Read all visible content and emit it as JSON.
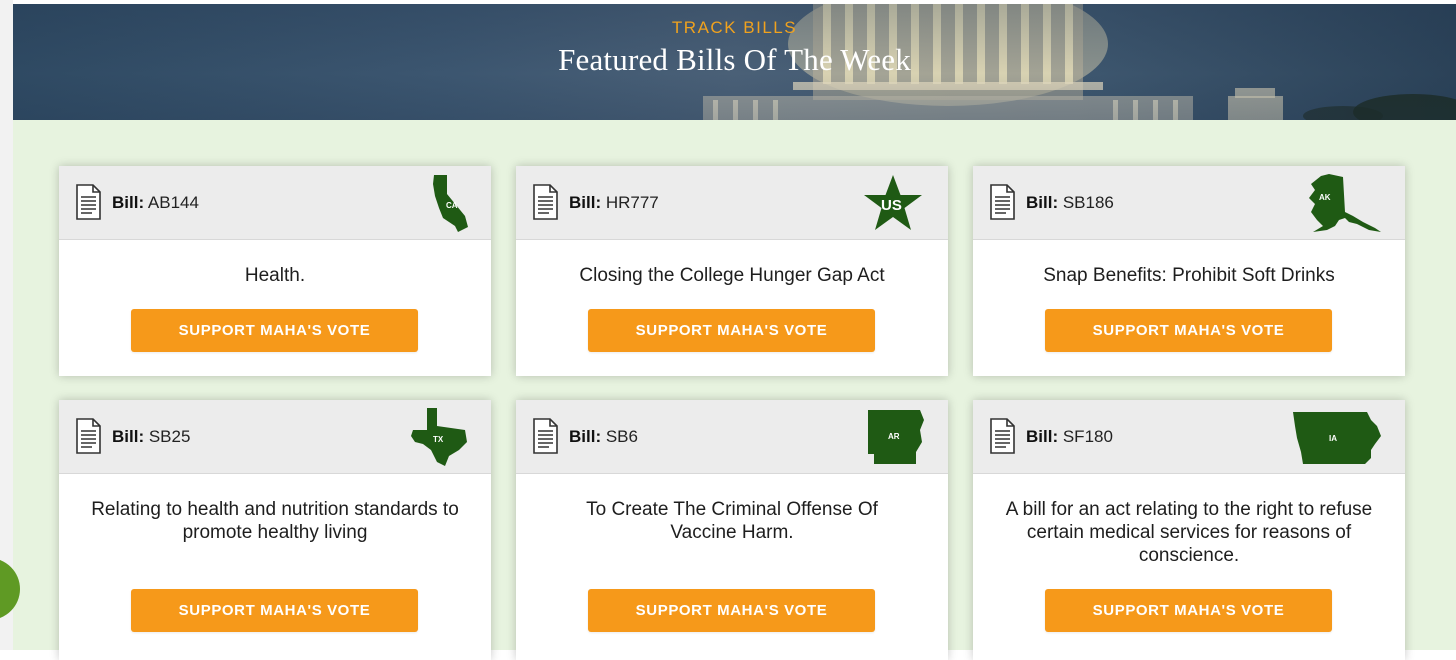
{
  "hero": {
    "eyebrow": "TRACK BILLS",
    "title": "Featured Bills Of The Week"
  },
  "colors": {
    "accent_orange": "#f6991a",
    "state_green": "#1f5a14",
    "grid_background": "#e7f3df",
    "hero_blue": "#3c5670"
  },
  "bill_label": "Bill:",
  "bills": [
    {
      "number": "AB144",
      "state": "CA",
      "title": "Health.",
      "button": "SUPPORT MAHA'S VOTE"
    },
    {
      "number": "HR777",
      "state": "US",
      "title": "Closing the College Hunger Gap Act",
      "button": "SUPPORT MAHA'S VOTE"
    },
    {
      "number": "SB186",
      "state": "AK",
      "title": "Snap Benefits: Prohibit Soft Drinks",
      "button": "SUPPORT MAHA'S VOTE"
    },
    {
      "number": "SB25",
      "state": "TX",
      "title": "Relating to health and nutrition standards to promote healthy living",
      "button": "SUPPORT MAHA'S VOTE"
    },
    {
      "number": "SB6",
      "state": "AR",
      "title": "To Create The Criminal Offense Of Vaccine Harm.",
      "button": "SUPPORT MAHA'S VOTE"
    },
    {
      "number": "SF180",
      "state": "IA",
      "title": "A bill for an act relating to the right to refuse certain medical services for reasons of conscience.",
      "button": "SUPPORT MAHA'S VOTE"
    }
  ],
  "icons": {
    "document": "document-icon",
    "state_map": "state-map-icon",
    "us_star": "star-icon",
    "chat": "chat-bubble-icon"
  }
}
